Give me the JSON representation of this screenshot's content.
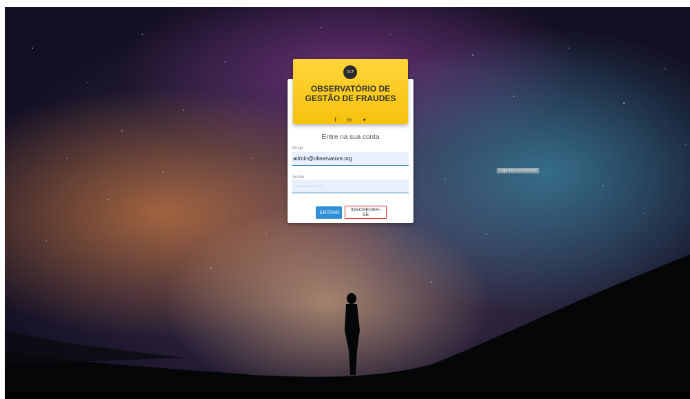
{
  "header": {
    "logo_text": "OGF",
    "title_line1": "OBSERVATÓRIO DE",
    "title_line2": "GESTÃO DE FRAUDES",
    "social": {
      "facebook": "f",
      "linkedin": "in",
      "twitter": "✦"
    }
  },
  "form": {
    "subtitle": "Entre na sua conta",
    "email_label": "Email",
    "email_value": "admin@observatore.org",
    "password_label": "Senha",
    "password_value": "············",
    "login_button": "ENTRAR",
    "signup_button": "INSCREVER-SE"
  },
  "overlay": {
    "tooltip": "Captured screenshot"
  },
  "colors": {
    "header_bg": "#f7c10c",
    "primary_button": "#2f8fd8",
    "highlight_border": "#e02020",
    "input_bg": "#e8f0fe"
  }
}
